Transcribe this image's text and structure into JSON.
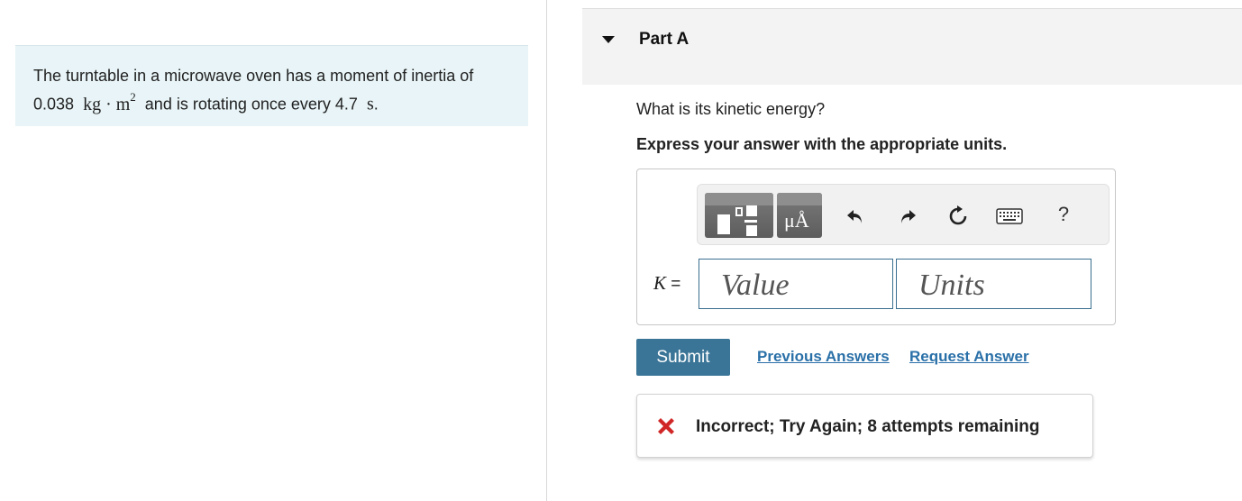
{
  "problem": {
    "line1": "The turntable in a microwave oven has a moment of inertia of",
    "inertia_value": "0.038",
    "inertia_units": "kg · m",
    "inertia_exponent": "2",
    "mid_text": "and is rotating once every 4.7",
    "period_units": "s",
    "end": "."
  },
  "part": {
    "title": "Part A"
  },
  "question": "What is its kinetic energy?",
  "instruction": "Express your answer with the appropriate units.",
  "toolbar": {
    "templates_icon": "fraction-template-icon",
    "units_icon": "units-icon",
    "units_glyph": "μÅ",
    "undo_icon": "undo-icon",
    "redo_icon": "redo-icon",
    "reset_icon": "reset-icon",
    "keyboard_icon": "keyboard-icon",
    "help_label": "?"
  },
  "answer": {
    "variable": "K",
    "equals": "=",
    "value": "",
    "value_placeholder": "Value",
    "units": "",
    "units_placeholder": "Units"
  },
  "actions": {
    "submit": "Submit",
    "previous_answers": "Previous Answers",
    "request_answer": "Request Answer"
  },
  "feedback": {
    "message": "Incorrect; Try Again; 8 attempts remaining",
    "icon": "error-x-icon"
  },
  "colors": {
    "problem_bg": "#e8f4f7",
    "primary": "#3a7597",
    "link": "#2a70a8",
    "error": "#d02626"
  }
}
